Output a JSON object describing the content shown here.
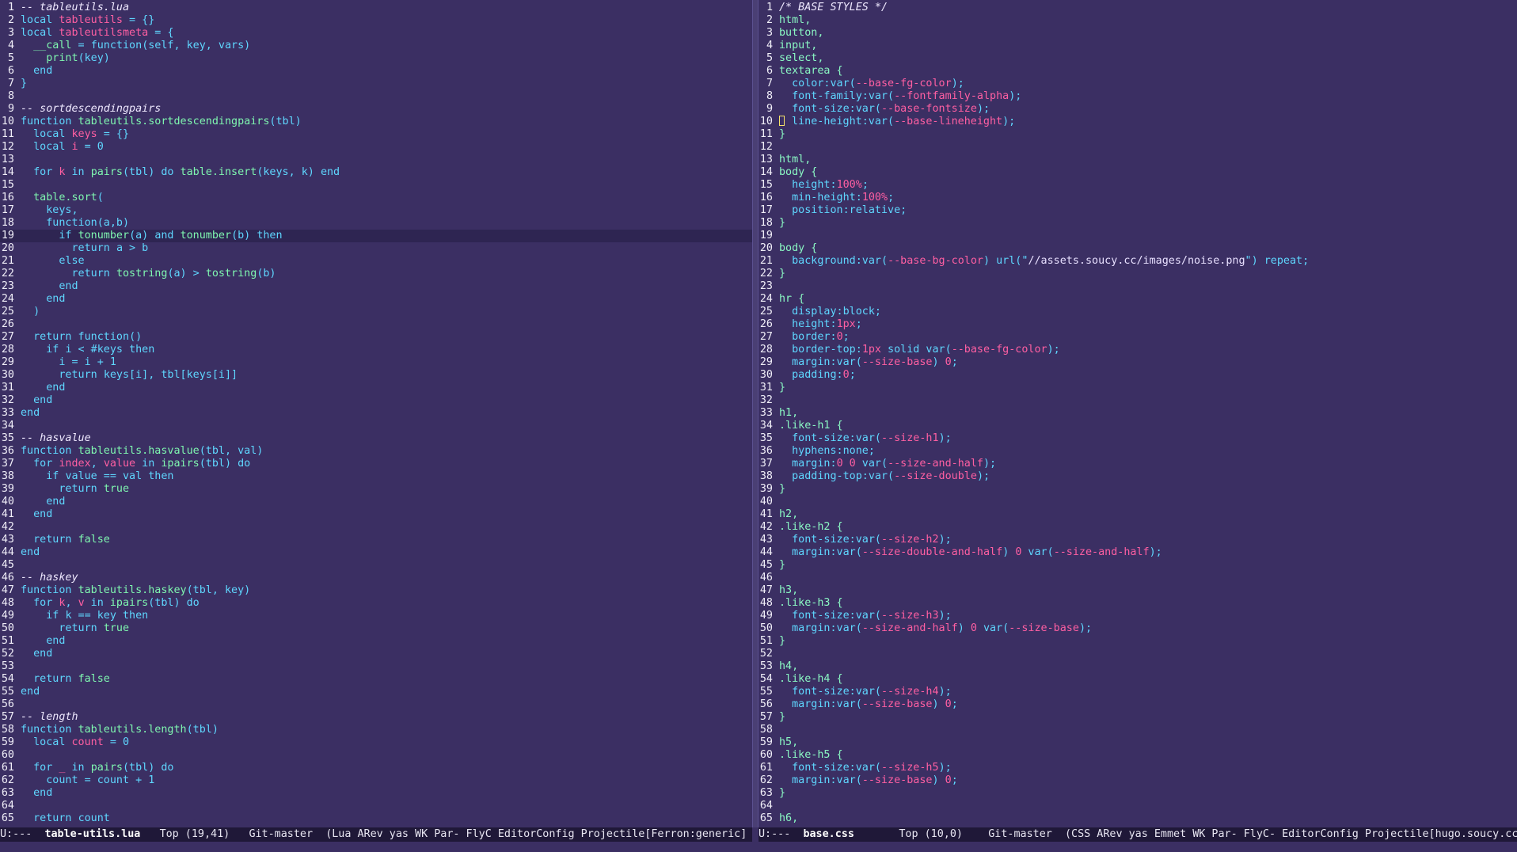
{
  "left": {
    "modeline": {
      "state": "U:---",
      "buffer": "table-utils.lua",
      "position": "Top (19,41)",
      "vc": "Git-master",
      "modes": "(Lua ARev yas WK Par- FlyC EditorConfig Projectile[Ferron:generic]"
    }
  },
  "right": {
    "modeline": {
      "state": "U:---",
      "buffer": "base.css",
      "position": "Top (10,0)",
      "vc": "Git-master",
      "modes": "(CSS ARev yas Emmet WK Par- FlyC- EditorConfig Projectile[hugo.soucy.cc"
    }
  },
  "left_lines": [
    [
      [
        "cm",
        "-- tableutils.lua"
      ]
    ],
    [
      [
        "kw",
        "local "
      ],
      [
        "va",
        "tableutils"
      ],
      [
        "pl",
        " = {}"
      ]
    ],
    [
      [
        "kw",
        "local "
      ],
      [
        "va",
        "tableutilsmeta"
      ],
      [
        "pl",
        " = {"
      ]
    ],
    [
      [
        "pl",
        "  "
      ],
      [
        "fn",
        "__call"
      ],
      [
        "pl",
        " = "
      ],
      [
        "kw",
        "function"
      ],
      [
        "pl",
        "(self, key, vars)"
      ]
    ],
    [
      [
        "pl",
        "    "
      ],
      [
        "fn",
        "print"
      ],
      [
        "pl",
        "(key)"
      ]
    ],
    [
      [
        "kw",
        "  end"
      ]
    ],
    [
      [
        "pl",
        "}"
      ]
    ],
    [],
    [
      [
        "cm",
        "-- sortdescendingpairs"
      ]
    ],
    [
      [
        "kw",
        "function "
      ],
      [
        "fn",
        "tableutils.sortdescendingpairs"
      ],
      [
        "pl",
        "(tbl)"
      ]
    ],
    [
      [
        "kw",
        "  local "
      ],
      [
        "va",
        "keys"
      ],
      [
        "pl",
        " = {}"
      ]
    ],
    [
      [
        "kw",
        "  local "
      ],
      [
        "va",
        "i"
      ],
      [
        "pl",
        " = 0"
      ]
    ],
    [],
    [
      [
        "kw",
        "  for "
      ],
      [
        "va",
        "k"
      ],
      [
        "kw",
        " in "
      ],
      [
        "fn",
        "pairs"
      ],
      [
        "pl",
        "(tbl) "
      ],
      [
        "kw",
        "do "
      ],
      [
        "fn",
        "table.insert"
      ],
      [
        "pl",
        "(keys, k) "
      ],
      [
        "kw",
        "end"
      ]
    ],
    [],
    [
      [
        "pl",
        "  "
      ],
      [
        "fn",
        "table.sort"
      ],
      [
        "pl",
        "("
      ]
    ],
    [
      [
        "pl",
        "    keys,"
      ]
    ],
    [
      [
        "kw",
        "    function"
      ],
      [
        "pl",
        "(a,b)"
      ]
    ],
    [
      [
        "kw",
        "      if "
      ],
      [
        "fn",
        "tonumber"
      ],
      [
        "pl",
        "(a) "
      ],
      [
        "kw",
        "and "
      ],
      [
        "fn",
        "tonumber"
      ],
      [
        "pl",
        "(b) "
      ],
      [
        "kw",
        "then"
      ]
    ],
    [
      [
        "kw",
        "        return "
      ],
      [
        "pl",
        "a > b"
      ]
    ],
    [
      [
        "kw",
        "      else"
      ]
    ],
    [
      [
        "kw",
        "        return "
      ],
      [
        "fn",
        "tostring"
      ],
      [
        "pl",
        "(a) > "
      ],
      [
        "fn",
        "tostring"
      ],
      [
        "pl",
        "(b)"
      ]
    ],
    [
      [
        "kw",
        "      end"
      ]
    ],
    [
      [
        "kw",
        "    end"
      ]
    ],
    [
      [
        "pl",
        "  )"
      ]
    ],
    [],
    [
      [
        "kw",
        "  return function"
      ],
      [
        "pl",
        "()"
      ]
    ],
    [
      [
        "kw",
        "    if "
      ],
      [
        "pl",
        "i < #keys "
      ],
      [
        "kw",
        "then"
      ]
    ],
    [
      [
        "pl",
        "      i = i + 1"
      ]
    ],
    [
      [
        "kw",
        "      return "
      ],
      [
        "pl",
        "keys[i], tbl[keys[i]]"
      ]
    ],
    [
      [
        "kw",
        "    end"
      ]
    ],
    [
      [
        "kw",
        "  end"
      ]
    ],
    [
      [
        "kw",
        "end"
      ]
    ],
    [],
    [
      [
        "cm",
        "-- hasvalue"
      ]
    ],
    [
      [
        "kw",
        "function "
      ],
      [
        "fn",
        "tableutils.hasvalue"
      ],
      [
        "pl",
        "(tbl, val)"
      ]
    ],
    [
      [
        "kw",
        "  for "
      ],
      [
        "va",
        "index"
      ],
      [
        "pl",
        ", "
      ],
      [
        "va",
        "value"
      ],
      [
        "kw",
        " in "
      ],
      [
        "fn",
        "ipairs"
      ],
      [
        "pl",
        "(tbl) "
      ],
      [
        "kw",
        "do"
      ]
    ],
    [
      [
        "kw",
        "    if "
      ],
      [
        "pl",
        "value == val "
      ],
      [
        "kw",
        "then"
      ]
    ],
    [
      [
        "kw",
        "      return "
      ],
      [
        "fn",
        "true"
      ]
    ],
    [
      [
        "kw",
        "    end"
      ]
    ],
    [
      [
        "kw",
        "  end"
      ]
    ],
    [],
    [
      [
        "kw",
        "  return "
      ],
      [
        "fn",
        "false"
      ]
    ],
    [
      [
        "kw",
        "end"
      ]
    ],
    [],
    [
      [
        "cm",
        "-- haskey"
      ]
    ],
    [
      [
        "kw",
        "function "
      ],
      [
        "fn",
        "tableutils.haskey"
      ],
      [
        "pl",
        "(tbl, key)"
      ]
    ],
    [
      [
        "kw",
        "  for "
      ],
      [
        "va",
        "k"
      ],
      [
        "pl",
        ", "
      ],
      [
        "va",
        "v"
      ],
      [
        "kw",
        " in "
      ],
      [
        "fn",
        "ipairs"
      ],
      [
        "pl",
        "(tbl) "
      ],
      [
        "kw",
        "do"
      ]
    ],
    [
      [
        "kw",
        "    if "
      ],
      [
        "pl",
        "k == key "
      ],
      [
        "kw",
        "then"
      ]
    ],
    [
      [
        "kw",
        "      return "
      ],
      [
        "fn",
        "true"
      ]
    ],
    [
      [
        "kw",
        "    end"
      ]
    ],
    [
      [
        "kw",
        "  end"
      ]
    ],
    [],
    [
      [
        "kw",
        "  return "
      ],
      [
        "fn",
        "false"
      ]
    ],
    [
      [
        "kw",
        "end"
      ]
    ],
    [],
    [
      [
        "cm",
        "-- length"
      ]
    ],
    [
      [
        "kw",
        "function "
      ],
      [
        "fn",
        "tableutils.length"
      ],
      [
        "pl",
        "(tbl)"
      ]
    ],
    [
      [
        "kw",
        "  local "
      ],
      [
        "va",
        "count"
      ],
      [
        "pl",
        " = 0"
      ]
    ],
    [],
    [
      [
        "kw",
        "  for "
      ],
      [
        "va",
        "_"
      ],
      [
        "kw",
        " in "
      ],
      [
        "fn",
        "pairs"
      ],
      [
        "pl",
        "(tbl) "
      ],
      [
        "kw",
        "do"
      ]
    ],
    [
      [
        "pl",
        "    count = count + 1"
      ]
    ],
    [
      [
        "kw",
        "  end"
      ]
    ],
    [],
    [
      [
        "kw",
        "  return "
      ],
      [
        "pl",
        "count"
      ]
    ]
  ],
  "right_lines": [
    [
      [
        "cm",
        "/* BASE STYLES */"
      ]
    ],
    [
      [
        "css-sel",
        "html,"
      ]
    ],
    [
      [
        "css-sel",
        "button,"
      ]
    ],
    [
      [
        "css-sel",
        "input,"
      ]
    ],
    [
      [
        "css-sel",
        "select,"
      ]
    ],
    [
      [
        "css-sel",
        "textarea {"
      ]
    ],
    [
      [
        "css-prop",
        "  color:var("
      ],
      [
        "css-var",
        "--base-fg-color"
      ],
      [
        "css-prop",
        ");"
      ]
    ],
    [
      [
        "css-prop",
        "  font-family:var("
      ],
      [
        "css-var",
        "--fontfamily-alpha"
      ],
      [
        "css-prop",
        ");"
      ]
    ],
    [
      [
        "css-prop",
        "  font-size:var("
      ],
      [
        "css-var",
        "--base-fontsize"
      ],
      [
        "css-prop",
        ");"
      ]
    ],
    [
      [
        "cursor",
        ""
      ],
      [
        "css-prop",
        " line-height:var("
      ],
      [
        "css-var",
        "--base-lineheight"
      ],
      [
        "css-prop",
        ");"
      ]
    ],
    [
      [
        "css-sel",
        "}"
      ]
    ],
    [],
    [
      [
        "css-sel",
        "html,"
      ]
    ],
    [
      [
        "css-sel",
        "body {"
      ]
    ],
    [
      [
        "css-prop",
        "  height:"
      ],
      [
        "css-var",
        "100%"
      ],
      [
        "css-prop",
        ";"
      ]
    ],
    [
      [
        "css-prop",
        "  min-height:"
      ],
      [
        "css-var",
        "100%"
      ],
      [
        "css-prop",
        ";"
      ]
    ],
    [
      [
        "css-prop",
        "  position:relative;"
      ]
    ],
    [
      [
        "css-sel",
        "}"
      ]
    ],
    [],
    [
      [
        "css-sel",
        "body {"
      ]
    ],
    [
      [
        "css-prop",
        "  background:var("
      ],
      [
        "css-var",
        "--base-bg-color"
      ],
      [
        "css-prop",
        ") url(\""
      ],
      [
        "str",
        "//assets.soucy.cc/images/noise.png"
      ],
      [
        "css-prop",
        "\") repeat;"
      ]
    ],
    [
      [
        "css-sel",
        "}"
      ]
    ],
    [],
    [
      [
        "css-sel",
        "hr {"
      ]
    ],
    [
      [
        "css-prop",
        "  display:block;"
      ]
    ],
    [
      [
        "css-prop",
        "  height:"
      ],
      [
        "css-var",
        "1px"
      ],
      [
        "css-prop",
        ";"
      ]
    ],
    [
      [
        "css-prop",
        "  border:"
      ],
      [
        "css-var",
        "0"
      ],
      [
        "css-prop",
        ";"
      ]
    ],
    [
      [
        "css-prop",
        "  border-top:"
      ],
      [
        "css-var",
        "1px"
      ],
      [
        "css-prop",
        " solid var("
      ],
      [
        "css-var",
        "--base-fg-color"
      ],
      [
        "css-prop",
        ");"
      ]
    ],
    [
      [
        "css-prop",
        "  margin:var("
      ],
      [
        "css-var",
        "--size-base"
      ],
      [
        "css-prop",
        ") "
      ],
      [
        "css-var",
        "0"
      ],
      [
        "css-prop",
        ";"
      ]
    ],
    [
      [
        "css-prop",
        "  padding:"
      ],
      [
        "css-var",
        "0"
      ],
      [
        "css-prop",
        ";"
      ]
    ],
    [
      [
        "css-sel",
        "}"
      ]
    ],
    [],
    [
      [
        "css-sel",
        "h1,"
      ]
    ],
    [
      [
        "css-sel",
        ".like-h1 {"
      ]
    ],
    [
      [
        "css-prop",
        "  font-size:var("
      ],
      [
        "css-var",
        "--size-h1"
      ],
      [
        "css-prop",
        ");"
      ]
    ],
    [
      [
        "css-prop",
        "  hyphens:none;"
      ]
    ],
    [
      [
        "css-prop",
        "  margin:"
      ],
      [
        "css-var",
        "0 0"
      ],
      [
        "css-prop",
        " var("
      ],
      [
        "css-var",
        "--size-and-half"
      ],
      [
        "css-prop",
        ");"
      ]
    ],
    [
      [
        "css-prop",
        "  padding-top:var("
      ],
      [
        "css-var",
        "--size-double"
      ],
      [
        "css-prop",
        ");"
      ]
    ],
    [
      [
        "css-sel",
        "}"
      ]
    ],
    [],
    [
      [
        "css-sel",
        "h2,"
      ]
    ],
    [
      [
        "css-sel",
        ".like-h2 {"
      ]
    ],
    [
      [
        "css-prop",
        "  font-size:var("
      ],
      [
        "css-var",
        "--size-h2"
      ],
      [
        "css-prop",
        ");"
      ]
    ],
    [
      [
        "css-prop",
        "  margin:var("
      ],
      [
        "css-var",
        "--size-double-and-half"
      ],
      [
        "css-prop",
        ") "
      ],
      [
        "css-var",
        "0"
      ],
      [
        "css-prop",
        " var("
      ],
      [
        "css-var",
        "--size-and-half"
      ],
      [
        "css-prop",
        ");"
      ]
    ],
    [
      [
        "css-sel",
        "}"
      ]
    ],
    [],
    [
      [
        "css-sel",
        "h3,"
      ]
    ],
    [
      [
        "css-sel",
        ".like-h3 {"
      ]
    ],
    [
      [
        "css-prop",
        "  font-size:var("
      ],
      [
        "css-var",
        "--size-h3"
      ],
      [
        "css-prop",
        ");"
      ]
    ],
    [
      [
        "css-prop",
        "  margin:var("
      ],
      [
        "css-var",
        "--size-and-half"
      ],
      [
        "css-prop",
        ") "
      ],
      [
        "css-var",
        "0"
      ],
      [
        "css-prop",
        " var("
      ],
      [
        "css-var",
        "--size-base"
      ],
      [
        "css-prop",
        ");"
      ]
    ],
    [
      [
        "css-sel",
        "}"
      ]
    ],
    [],
    [
      [
        "css-sel",
        "h4,"
      ]
    ],
    [
      [
        "css-sel",
        ".like-h4 {"
      ]
    ],
    [
      [
        "css-prop",
        "  font-size:var("
      ],
      [
        "css-var",
        "--size-h4"
      ],
      [
        "css-prop",
        ");"
      ]
    ],
    [
      [
        "css-prop",
        "  margin:var("
      ],
      [
        "css-var",
        "--size-base"
      ],
      [
        "css-prop",
        ") "
      ],
      [
        "css-var",
        "0"
      ],
      [
        "css-prop",
        ";"
      ]
    ],
    [
      [
        "css-sel",
        "}"
      ]
    ],
    [],
    [
      [
        "css-sel",
        "h5,"
      ]
    ],
    [
      [
        "css-sel",
        ".like-h5 {"
      ]
    ],
    [
      [
        "css-prop",
        "  font-size:var("
      ],
      [
        "css-var",
        "--size-h5"
      ],
      [
        "css-prop",
        ");"
      ]
    ],
    [
      [
        "css-prop",
        "  margin:var("
      ],
      [
        "css-var",
        "--size-base"
      ],
      [
        "css-prop",
        ") "
      ],
      [
        "css-var",
        "0"
      ],
      [
        "css-prop",
        ";"
      ]
    ],
    [
      [
        "css-sel",
        "}"
      ]
    ],
    [],
    [
      [
        "css-sel",
        "h6,"
      ]
    ]
  ]
}
